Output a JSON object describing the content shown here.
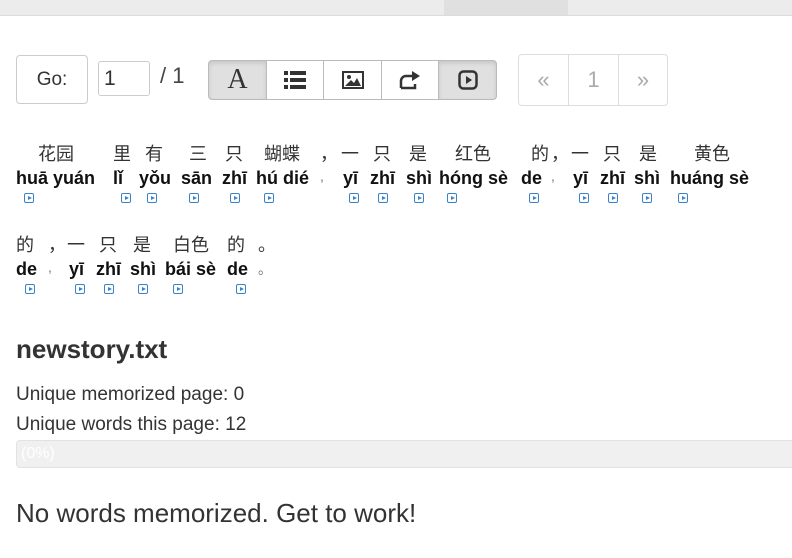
{
  "nav": {
    "go_label": "Go:",
    "page_value": "1",
    "page_total": "/ 1"
  },
  "toolbar": {
    "font_label": "A",
    "icons": [
      "font-icon",
      "list-icon",
      "image-icon",
      "share-icon",
      "play-icon"
    ]
  },
  "pager": {
    "prev": "«",
    "current": "1",
    "next": "»"
  },
  "story": {
    "words": [
      {
        "hanzi": "花园",
        "pinyin": "huā yuán"
      },
      {
        "hanzi": "里",
        "pinyin": "lǐ"
      },
      {
        "hanzi": "有",
        "pinyin": "yǒu"
      },
      {
        "hanzi": "三",
        "pinyin": "sān"
      },
      {
        "hanzi": "只",
        "pinyin": "zhī"
      },
      {
        "hanzi": "蝴蝶",
        "pinyin": "hú dié"
      },
      {
        "hanzi": "，",
        "pinyin": ","
      },
      {
        "hanzi": "一",
        "pinyin": "yī"
      },
      {
        "hanzi": "只",
        "pinyin": "zhī"
      },
      {
        "hanzi": "是",
        "pinyin": "shì"
      },
      {
        "hanzi": "红色",
        "pinyin": "hóng sè"
      },
      {
        "hanzi": "的",
        "pinyin": "de"
      },
      {
        "hanzi": "，",
        "pinyin": ","
      },
      {
        "hanzi": "一",
        "pinyin": "yī"
      },
      {
        "hanzi": "只",
        "pinyin": "zhī"
      },
      {
        "hanzi": "是",
        "pinyin": "shì"
      },
      {
        "hanzi": "黄色",
        "pinyin": "huáng sè"
      },
      {
        "hanzi": "的",
        "pinyin": "de"
      },
      {
        "hanzi": "，",
        "pinyin": ","
      },
      {
        "hanzi": "一",
        "pinyin": "yī"
      },
      {
        "hanzi": "只",
        "pinyin": "zhī"
      },
      {
        "hanzi": "是",
        "pinyin": "shì"
      },
      {
        "hanzi": "白色",
        "pinyin": "bái sè"
      },
      {
        "hanzi": "的",
        "pinyin": "de"
      },
      {
        "hanzi": "。",
        "pinyin": "。"
      }
    ]
  },
  "document": {
    "filename": "newstory.txt",
    "memorized_label": "Unique memorized page: 0",
    "unique_words_label": "Unique words this page: 12",
    "progress_percent": 0,
    "progress_label": "(0%)",
    "message": "No words memorized. Get to work!"
  },
  "colors": {
    "accent": "#3b83c9"
  }
}
